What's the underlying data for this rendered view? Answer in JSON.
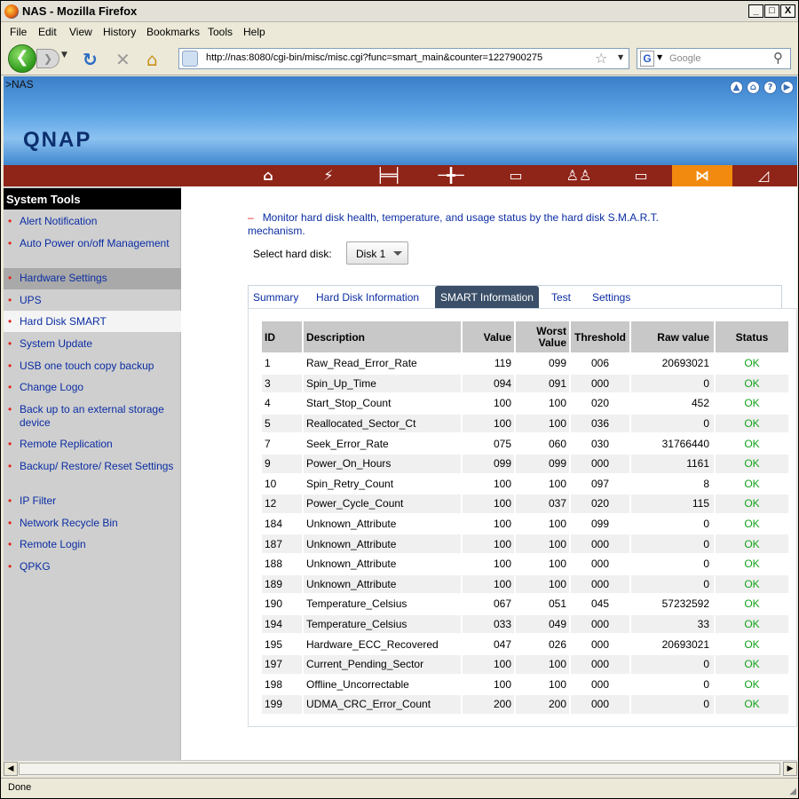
{
  "window": {
    "title": "NAS - Mozilla Firefox",
    "min": "_",
    "max": "□",
    "close": "X"
  },
  "menu": [
    "File",
    "Edit",
    "View",
    "History",
    "Bookmarks",
    "Tools",
    "Help"
  ],
  "nav": {
    "url": "http://nas:8080/cgi-bin/misc/misc.cgi?func=smart_main&counter=1227900275",
    "search_placeholder": "Google",
    "search_engine_letter": "G"
  },
  "banner": {
    "breadcrumb": ">NAS",
    "logo": "QNAP",
    "top_icons": [
      "up-icon",
      "home-icon",
      "help-icon",
      "next-icon"
    ]
  },
  "topnav": [
    {
      "icon": "home-nav-icon",
      "glyph": "⌂"
    },
    {
      "icon": "quick-config-icon",
      "glyph": "⚡"
    },
    {
      "icon": "system-settings-icon",
      "glyph": "╞═╡"
    },
    {
      "icon": "network-icon",
      "glyph": "─╋─"
    },
    {
      "icon": "disk-icon",
      "glyph": "▭"
    },
    {
      "icon": "users-icon",
      "glyph": "♙♙"
    },
    {
      "icon": "network-share-icon",
      "glyph": "▭"
    },
    {
      "icon": "system-tools-icon",
      "glyph": "⋈",
      "active": true
    },
    {
      "icon": "logs-icon",
      "glyph": "◿"
    }
  ],
  "sidebar": {
    "title": "System Tools",
    "items": [
      {
        "label": "Alert Notification",
        "lines": 1
      },
      {
        "label": "Auto Power on/off Management",
        "lines": 2
      },
      {
        "label": "Hardware Settings",
        "lines": 1,
        "state": "dark"
      },
      {
        "label": "UPS",
        "lines": 1
      },
      {
        "label": "Hard Disk SMART",
        "lines": 1,
        "state": "white"
      },
      {
        "label": "System Update",
        "lines": 1
      },
      {
        "label": "USB one touch copy backup",
        "lines": 1
      },
      {
        "label": "Change Logo",
        "lines": 1
      },
      {
        "label": "Back up to an external storage device",
        "lines": 2
      },
      {
        "label": "Remote Replication",
        "lines": 1
      },
      {
        "label": "Backup/ Restore/ Reset Settings",
        "lines": 2
      },
      {
        "label": "IP Filter",
        "lines": 1
      },
      {
        "label": "Network Recycle Bin",
        "lines": 1
      },
      {
        "label": "Remote Login",
        "lines": 1
      },
      {
        "label": "QPKG",
        "lines": 1
      }
    ]
  },
  "main": {
    "description": "Monitor hard disk health, temperature, and usage status by the hard disk S.M.A.R.T. mechanism.",
    "select_label": "Select hard disk:",
    "select_value": "Disk 1",
    "tabs": [
      {
        "label": "Summary"
      },
      {
        "label": "Hard Disk Information"
      },
      {
        "label": "SMART Information",
        "active": true
      },
      {
        "label": "Test"
      },
      {
        "label": "Settings"
      }
    ]
  },
  "table": {
    "headers": {
      "id": "ID",
      "desc": "Description",
      "value": "Value",
      "worst": "Worst Value",
      "threshold": "Threshold",
      "raw": "Raw value",
      "status": "Status"
    },
    "rows": [
      [
        "1",
        "Raw_Read_Error_Rate",
        "119",
        "099",
        "006",
        "20693021",
        "OK"
      ],
      [
        "3",
        "Spin_Up_Time",
        "094",
        "091",
        "000",
        "0",
        "OK"
      ],
      [
        "4",
        "Start_Stop_Count",
        "100",
        "100",
        "020",
        "452",
        "OK"
      ],
      [
        "5",
        "Reallocated_Sector_Ct",
        "100",
        "100",
        "036",
        "0",
        "OK"
      ],
      [
        "7",
        "Seek_Error_Rate",
        "075",
        "060",
        "030",
        "31766440",
        "OK"
      ],
      [
        "9",
        "Power_On_Hours",
        "099",
        "099",
        "000",
        "1161",
        "OK"
      ],
      [
        "10",
        "Spin_Retry_Count",
        "100",
        "100",
        "097",
        "8",
        "OK"
      ],
      [
        "12",
        "Power_Cycle_Count",
        "100",
        "037",
        "020",
        "115",
        "OK"
      ],
      [
        "184",
        "Unknown_Attribute",
        "100",
        "100",
        "099",
        "0",
        "OK"
      ],
      [
        "187",
        "Unknown_Attribute",
        "100",
        "100",
        "000",
        "0",
        "OK"
      ],
      [
        "188",
        "Unknown_Attribute",
        "100",
        "100",
        "000",
        "0",
        "OK"
      ],
      [
        "189",
        "Unknown_Attribute",
        "100",
        "100",
        "000",
        "0",
        "OK"
      ],
      [
        "190",
        "Temperature_Celsius",
        "067",
        "051",
        "045",
        "57232592",
        "OK"
      ],
      [
        "194",
        "Temperature_Celsius",
        "033",
        "049",
        "000",
        "33",
        "OK"
      ],
      [
        "195",
        "Hardware_ECC_Recovered",
        "047",
        "026",
        "000",
        "20693021",
        "OK"
      ],
      [
        "197",
        "Current_Pending_Sector",
        "100",
        "100",
        "000",
        "0",
        "OK"
      ],
      [
        "198",
        "Offline_Uncorrectable",
        "100",
        "100",
        "000",
        "0",
        "OK"
      ],
      [
        "199",
        "UDMA_CRC_Error_Count",
        "200",
        "200",
        "000",
        "0",
        "OK"
      ]
    ]
  },
  "statusbar": {
    "text": "Done"
  },
  "colors": {
    "brand_red": "#8f2418",
    "active_orange": "#f18a0f",
    "link_blue": "#0b2da3",
    "ok_green": "#13a31b"
  }
}
